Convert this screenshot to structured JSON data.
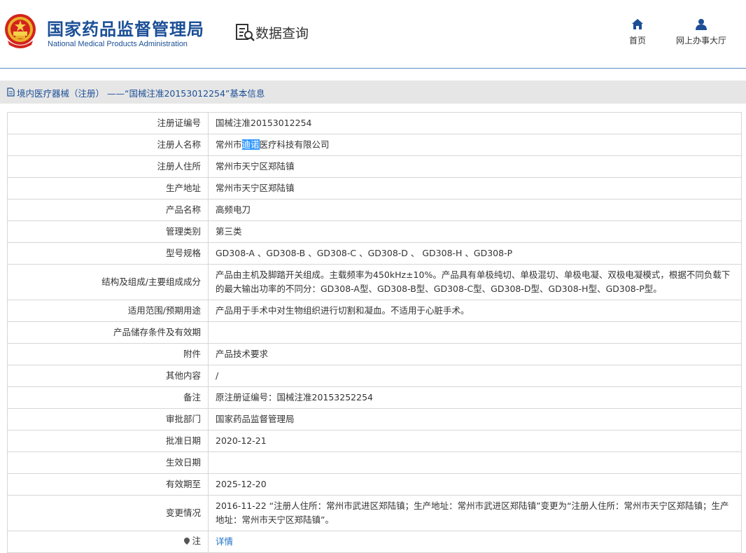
{
  "header": {
    "org_name_cn": "国家药品监督管理局",
    "org_name_en": "National Medical Products Administration",
    "section_title": "数据查询",
    "nav": [
      {
        "label": "首页",
        "icon": "home-icon"
      },
      {
        "label": "网上办事大厅",
        "icon": "user-icon"
      }
    ]
  },
  "breadcrumb": {
    "text": "境内医疗器械（注册） ——“国械注准20153012254”基本信息",
    "icon": "document-icon"
  },
  "table": {
    "rows": [
      {
        "label": "注册证编号",
        "value": "国械注准20153012254"
      },
      {
        "label": "注册人名称",
        "value_before": "常州市",
        "value_highlight": "迪诺",
        "value_after": "医疗科技有限公司"
      },
      {
        "label": "注册人住所",
        "value": "常州市天宁区郑陆镇"
      },
      {
        "label": "生产地址",
        "value": "常州市天宁区郑陆镇"
      },
      {
        "label": "产品名称",
        "value": "高频电刀"
      },
      {
        "label": "管理类别",
        "value": "第三类"
      },
      {
        "label": "型号规格",
        "value": "GD308-A 、GD308-B 、GD308-C 、GD308-D 、 GD308-H 、GD308-P"
      },
      {
        "label": "结构及组成/主要组成成分",
        "value": "产品由主机及脚踏开关组成。主载频率为450kHz±10%。产品具有单极纯切、单极混切、单极电凝、双极电凝模式，根据不同负载下的最大输出功率的不同分：GD308-A型、GD308-B型、GD308-C型、GD308-D型、GD308-H型、GD308-P型。"
      },
      {
        "label": "适用范围/预期用途",
        "value": "产品用于手术中对生物组织进行切割和凝血。不适用于心脏手术。"
      },
      {
        "label": "产品储存条件及有效期",
        "value": ""
      },
      {
        "label": "附件",
        "value": "产品技术要求"
      },
      {
        "label": "其他内容",
        "value": "/"
      },
      {
        "label": "备注",
        "value": "原注册证编号：国械注准20153252254"
      },
      {
        "label": "审批部门",
        "value": "国家药品监督管理局"
      },
      {
        "label": "批准日期",
        "value": "2020-12-21"
      },
      {
        "label": "生效日期",
        "value": ""
      },
      {
        "label": "有效期至",
        "value": "2025-12-20"
      },
      {
        "label": "变更情况",
        "value": "2016-11-22 “注册人住所：常州市武进区郑陆镇；生产地址：常州市武进区郑陆镇”变更为“注册人住所：常州市天宁区郑陆镇；生产地址：常州市天宁区郑陆镇”。"
      },
      {
        "label": "注",
        "value": "详情",
        "label_icon": "pin-icon"
      }
    ]
  },
  "colors": {
    "brand_blue": "#1b4f96",
    "header_line": "#5b8ec4",
    "breadcrumb_bg": "#e6e6e6",
    "border": "#d6d6d6",
    "highlight": "#3399ff",
    "link": "#1b6fc2"
  }
}
